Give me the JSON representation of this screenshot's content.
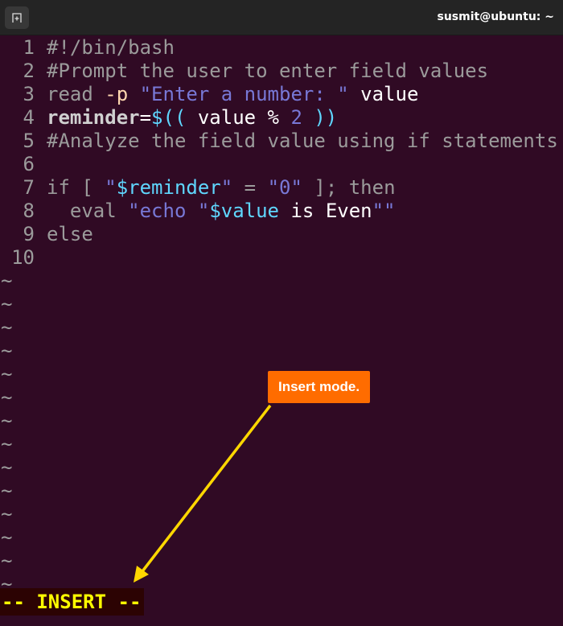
{
  "window": {
    "title": "susmit@ubuntu: ~",
    "new_tab_icon": "new-tab-icon"
  },
  "editor": {
    "lines": [
      {
        "num": "1",
        "segments": [
          {
            "t": "#!/bin/bash",
            "c": "c-gray"
          }
        ]
      },
      {
        "num": "2",
        "segments": [
          {
            "t": "#Prompt the user to enter field values",
            "c": "c-gray"
          }
        ]
      },
      {
        "num": "3",
        "segments": [
          {
            "t": "read ",
            "c": "c-gray"
          },
          {
            "t": "-p",
            "c": "c-opt"
          },
          {
            "t": " ",
            "c": "c-gray"
          },
          {
            "t": "\"Enter a number: \"",
            "c": "c-str"
          },
          {
            "t": " value",
            "c": "c-white"
          }
        ]
      },
      {
        "num": "4",
        "segments": [
          {
            "t": "reminder",
            "c": "c-bold"
          },
          {
            "t": "=",
            "c": "c-white"
          },
          {
            "t": "$((",
            "c": "c-var"
          },
          {
            "t": " value % ",
            "c": "c-white"
          },
          {
            "t": "2",
            "c": "c-str"
          },
          {
            "t": " ))",
            "c": "c-var"
          }
        ]
      },
      {
        "num": "5",
        "segments": [
          {
            "t": "#Analyze the field value using if statements",
            "c": "c-gray"
          }
        ]
      },
      {
        "num": "6",
        "segments": []
      },
      {
        "num": "7",
        "segments": [
          {
            "t": "if [ ",
            "c": "c-gray"
          },
          {
            "t": "\"",
            "c": "c-str"
          },
          {
            "t": "$reminder",
            "c": "c-var"
          },
          {
            "t": "\"",
            "c": "c-str"
          },
          {
            "t": " = ",
            "c": "c-gray"
          },
          {
            "t": "\"0\"",
            "c": "c-str"
          },
          {
            "t": " ]; then",
            "c": "c-gray"
          }
        ]
      },
      {
        "num": "8",
        "segments": [
          {
            "t": "  eval ",
            "c": "c-gray"
          },
          {
            "t": "\"echo \"",
            "c": "c-str"
          },
          {
            "t": "$value",
            "c": "c-var"
          },
          {
            "t": " is Even",
            "c": "c-white"
          },
          {
            "t": "\"\"",
            "c": "c-str"
          }
        ]
      },
      {
        "num": "9",
        "segments": [
          {
            "t": "else",
            "c": "c-gray"
          }
        ]
      },
      {
        "num": "10",
        "segments": []
      }
    ],
    "empty_line_marker": "~",
    "empty_line_count": 14
  },
  "status_line": {
    "mode_text": "-- INSERT --"
  },
  "annotation": {
    "callout_text": "Insert mode.",
    "callout_color": "#ff6c00",
    "arrow_color": "#ffd700"
  },
  "colors": {
    "background": "#300a24",
    "titlebar": "#242424",
    "status_fg": "#ffff00"
  }
}
